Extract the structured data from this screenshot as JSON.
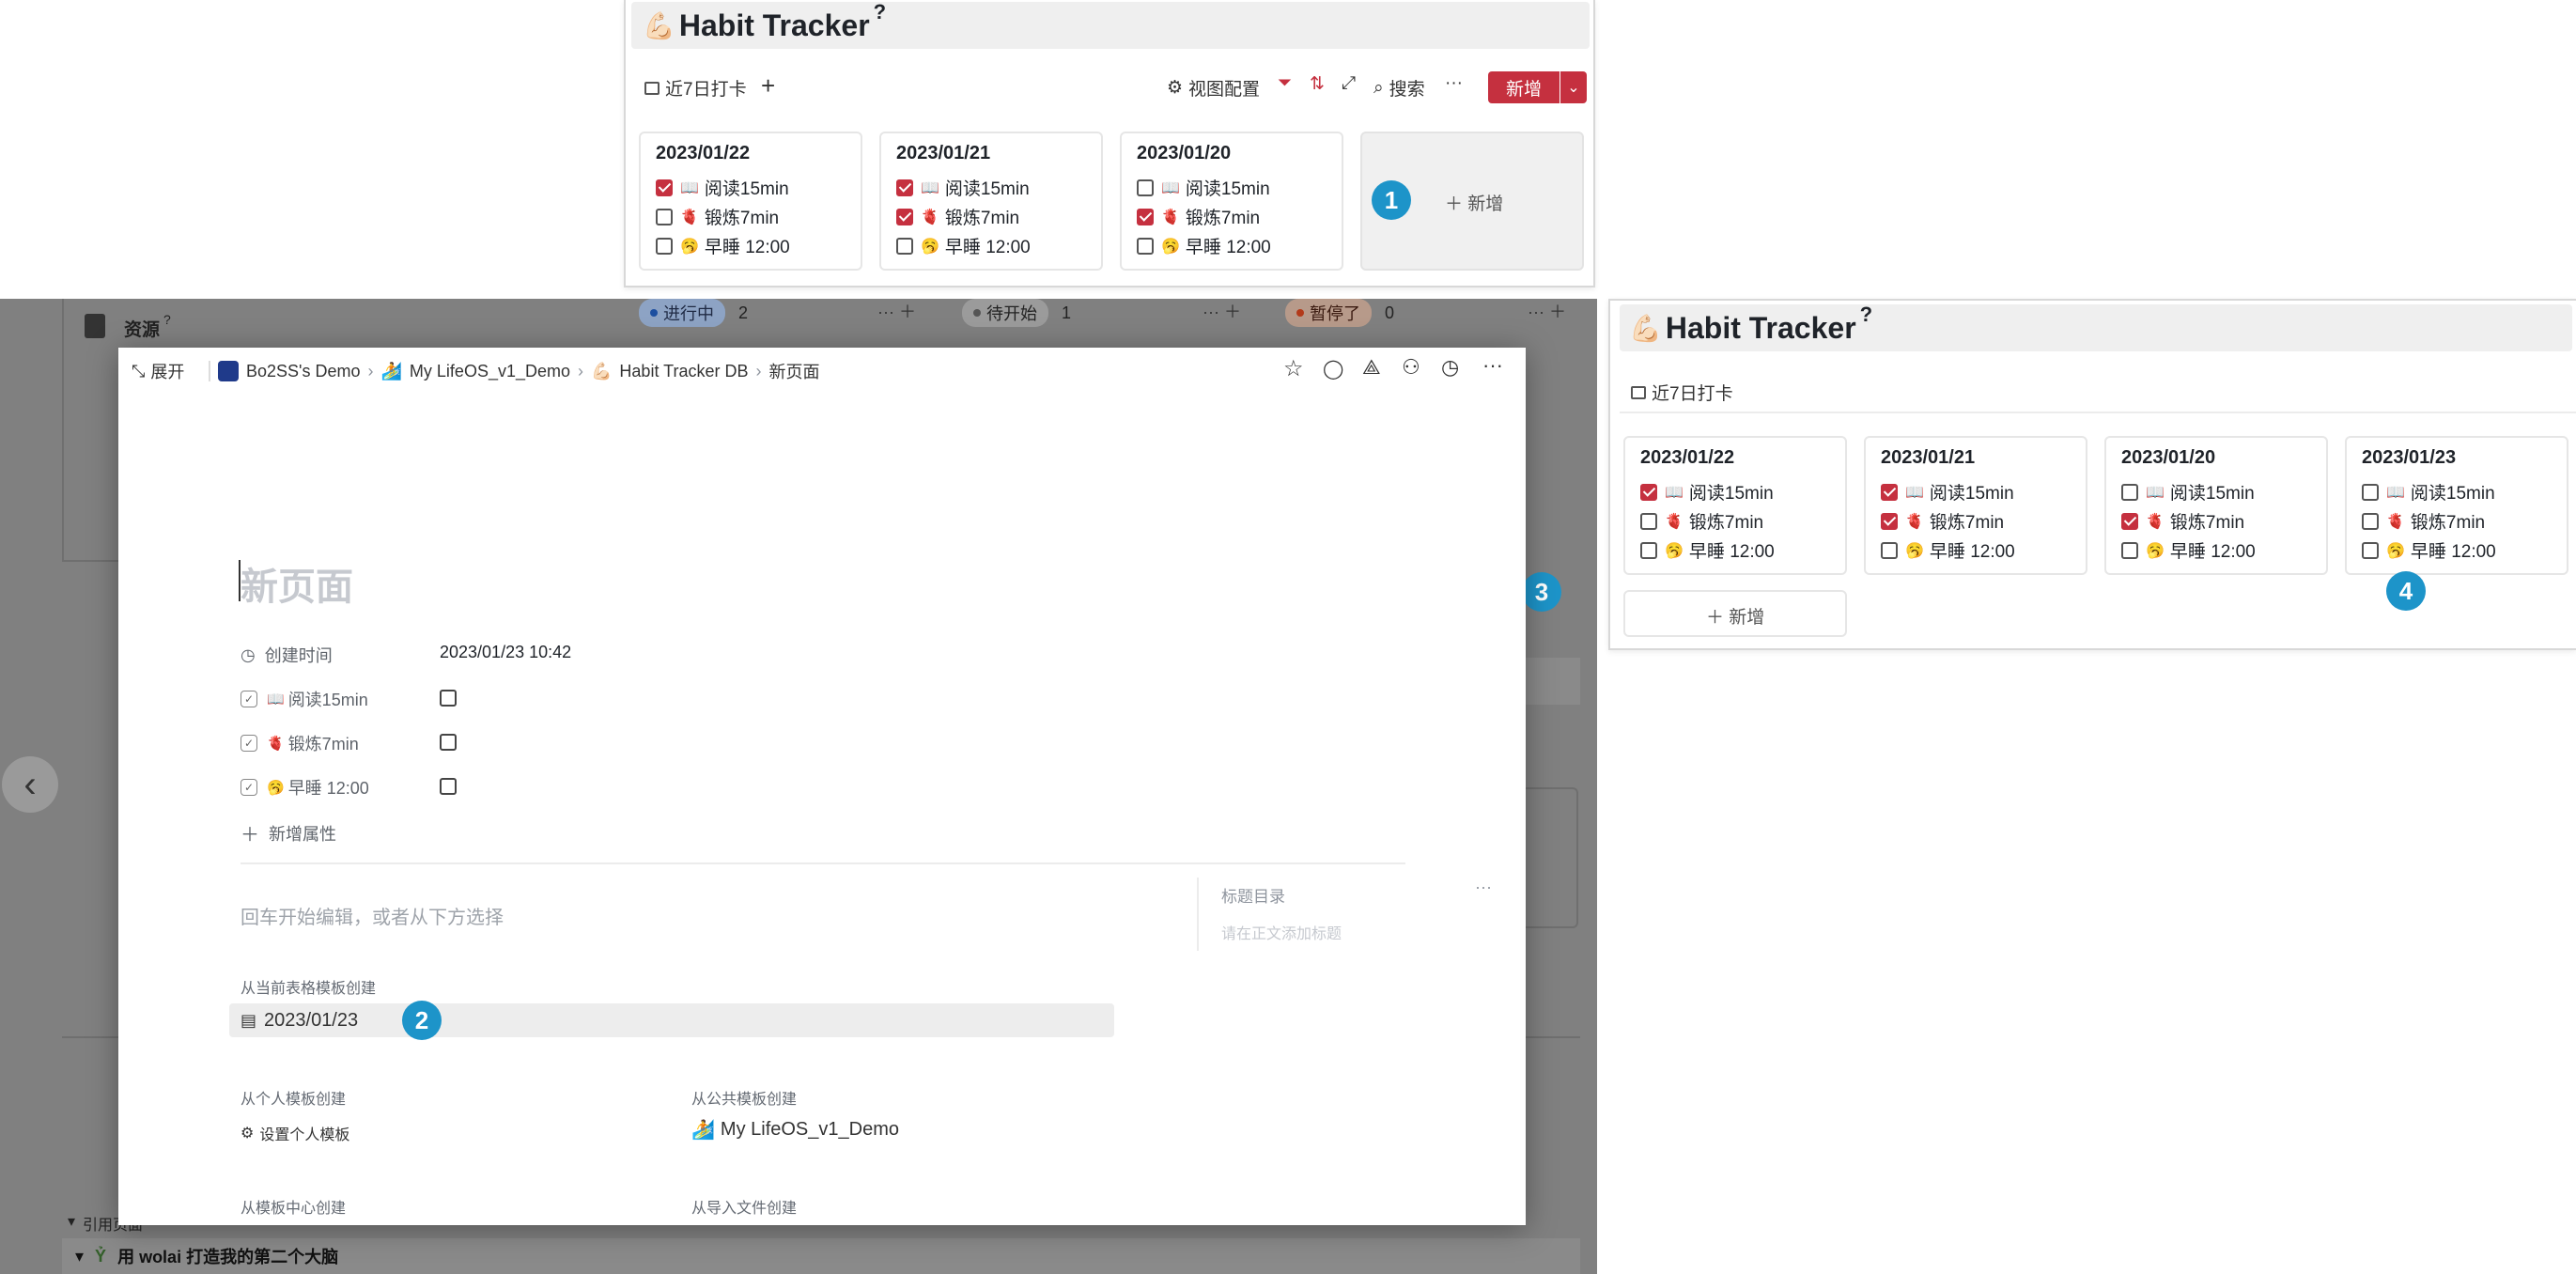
{
  "colors": {
    "accent": "#c5303f",
    "badge": "#1d94c9",
    "overlay": "#808080"
  },
  "top_panel": {
    "emoji": "💪🏻",
    "title": "Habit Tracker",
    "qmark": "?",
    "view_tab": "近7日打卡",
    "add_view": "+",
    "toolbar": {
      "view_config": "视图配置",
      "search": "搜索",
      "more": "···",
      "new_button": "新增",
      "dropdown": "⌄"
    },
    "cards": [
      {
        "date": "2023/01/22",
        "items": [
          {
            "emoji": "📖",
            "label": "阅读15min",
            "checked": true
          },
          {
            "emoji": "🫀",
            "label": "锻炼7min",
            "checked": false
          },
          {
            "emoji": "🥱",
            "label": "早睡 12:00",
            "checked": false
          }
        ]
      },
      {
        "date": "2023/01/21",
        "items": [
          {
            "emoji": "📖",
            "label": "阅读15min",
            "checked": true
          },
          {
            "emoji": "🫀",
            "label": "锻炼7min",
            "checked": true
          },
          {
            "emoji": "🥱",
            "label": "早睡 12:00",
            "checked": false
          }
        ]
      },
      {
        "date": "2023/01/20",
        "items": [
          {
            "emoji": "📖",
            "label": "阅读15min",
            "checked": false
          },
          {
            "emoji": "🫀",
            "label": "锻炼7min",
            "checked": true
          },
          {
            "emoji": "🥱",
            "label": "早睡 12:00",
            "checked": false
          }
        ]
      }
    ],
    "add_card": "＋ 新增",
    "badge": "1"
  },
  "background": {
    "sidebar_label": "资源",
    "sidebar_qmark": "?",
    "kanban": [
      {
        "label": "进行中",
        "count": "2"
      },
      {
        "label": "待开始",
        "count": "1"
      },
      {
        "label": "暂停了",
        "count": "0"
      }
    ],
    "backlinks": "引用页面",
    "bottom_item": "用 wolai 打造我的第二个大脑",
    "nav_prev": "‹",
    "badge3": "3"
  },
  "modal": {
    "expand": "展开",
    "breadcrumb": [
      "Bo2SS's Demo",
      "My LifeOS_v1_Demo",
      "Habit Tracker DB",
      "新页面"
    ],
    "page_title": "新页面",
    "props": [
      {
        "label": "创建时间",
        "value": "2023/01/23 10:42"
      },
      {
        "emoji": "📖",
        "label": "阅读15min"
      },
      {
        "emoji": "🫀",
        "label": "锻炼7min"
      },
      {
        "emoji": "🥱",
        "label": "早睡 12:00"
      }
    ],
    "add_prop": "新增属性",
    "placeholder": "回车开始编辑，或者从下方选择",
    "toc_title": "标题目录",
    "toc_empty": "请在正文添加标题",
    "toc_more": "···",
    "from_table_template": "从当前表格模板创建",
    "template_item": "2023/01/23",
    "badge2": "2",
    "from_personal": "从个人模板创建",
    "set_personal": "设置个人模板",
    "from_public": "从公共模板创建",
    "public_item": "My LifeOS_v1_Demo",
    "from_center": "从模板中心创建",
    "from_import": "从导入文件创建"
  },
  "right_panel": {
    "emoji": "💪🏻",
    "title": "Habit Tracker",
    "qmark": "?",
    "view_tab": "近7日打卡",
    "cards": [
      {
        "date": "2023/01/22",
        "items": [
          {
            "emoji": "📖",
            "label": "阅读15min",
            "checked": true
          },
          {
            "emoji": "🫀",
            "label": "锻炼7min",
            "checked": false
          },
          {
            "emoji": "🥱",
            "label": "早睡 12:00",
            "checked": false
          }
        ]
      },
      {
        "date": "2023/01/21",
        "items": [
          {
            "emoji": "📖",
            "label": "阅读15min",
            "checked": true
          },
          {
            "emoji": "🫀",
            "label": "锻炼7min",
            "checked": true
          },
          {
            "emoji": "🥱",
            "label": "早睡 12:00",
            "checked": false
          }
        ]
      },
      {
        "date": "2023/01/20",
        "items": [
          {
            "emoji": "📖",
            "label": "阅读15min",
            "checked": false
          },
          {
            "emoji": "🫀",
            "label": "锻炼7min",
            "checked": true
          },
          {
            "emoji": "🥱",
            "label": "早睡 12:00",
            "checked": false
          }
        ]
      },
      {
        "date": "2023/01/23",
        "items": [
          {
            "emoji": "📖",
            "label": "阅读15min",
            "checked": false
          },
          {
            "emoji": "🫀",
            "label": "锻炼7min",
            "checked": false
          },
          {
            "emoji": "🥱",
            "label": "早睡 12:00",
            "checked": false
          }
        ]
      }
    ],
    "add_card": "＋ 新增",
    "badge": "4"
  }
}
